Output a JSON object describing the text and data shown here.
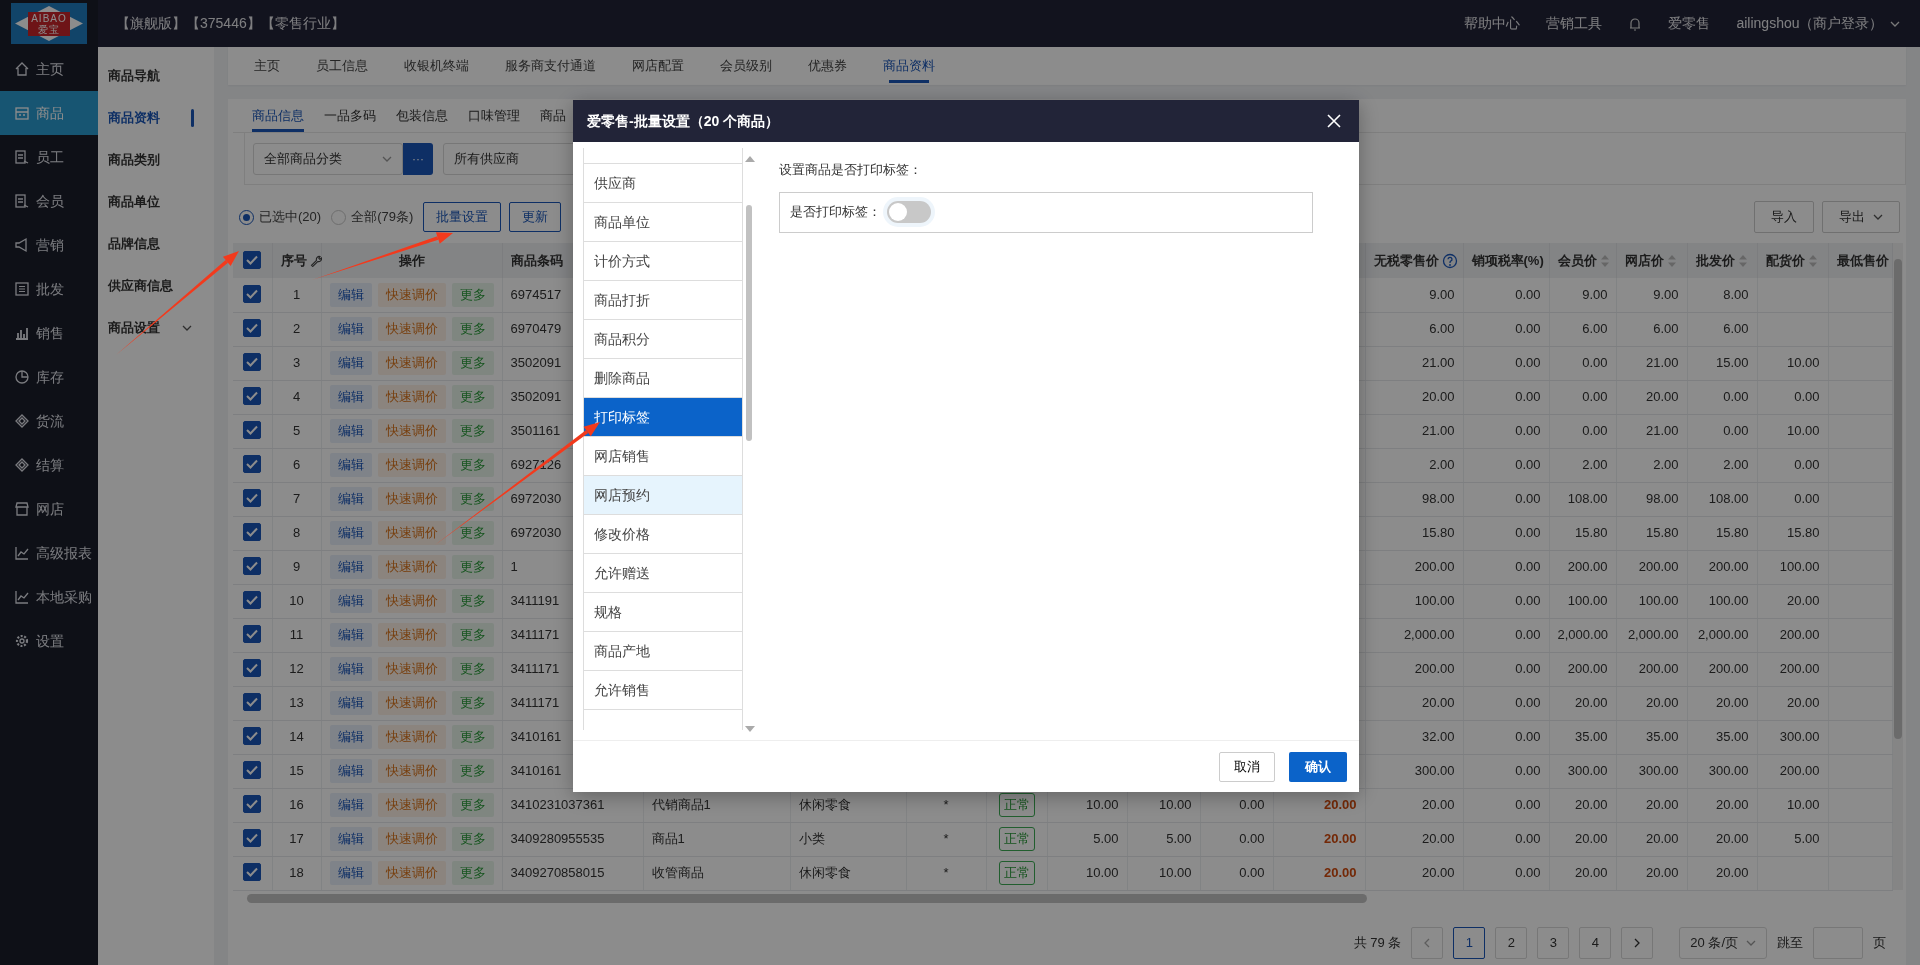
{
  "logo": {
    "text": "AIBAO",
    "subtext": "爱宝"
  },
  "header": {
    "title": "【旗舰版】【375446】【零售行业】",
    "links": [
      "帮助中心",
      "营销工具"
    ],
    "app": "爱零售",
    "user": "ailingshou（商户登录）"
  },
  "sidebar": {
    "items": [
      {
        "label": "主页",
        "selected": false
      },
      {
        "label": "商品",
        "selected": true
      },
      {
        "label": "员工",
        "selected": false
      },
      {
        "label": "会员",
        "selected": false
      },
      {
        "label": "营销",
        "selected": false
      },
      {
        "label": "批发",
        "selected": false
      },
      {
        "label": "销售",
        "selected": false
      },
      {
        "label": "库存",
        "selected": false
      },
      {
        "label": "货流",
        "selected": false
      },
      {
        "label": "结算",
        "selected": false
      },
      {
        "label": "网店",
        "selected": false
      },
      {
        "label": "高级报表",
        "selected": false
      },
      {
        "label": "本地采购",
        "selected": false
      },
      {
        "label": "设置",
        "selected": false
      }
    ]
  },
  "subnav": {
    "items": [
      {
        "label": "商品导航",
        "selected": false,
        "kind": "link"
      },
      {
        "label": "商品资料",
        "selected": true,
        "kind": "link"
      },
      {
        "label": "商品类别",
        "selected": false,
        "kind": "link"
      },
      {
        "label": "商品单位",
        "selected": false,
        "kind": "link"
      },
      {
        "label": "品牌信息",
        "selected": false,
        "kind": "link"
      },
      {
        "label": "供应商信息",
        "selected": false,
        "kind": "link"
      },
      {
        "label": "商品设置",
        "selected": false,
        "kind": "group",
        "expanded": false
      }
    ]
  },
  "tabs": [
    {
      "label": "主页",
      "selected": false
    },
    {
      "label": "员工信息",
      "selected": false
    },
    {
      "label": "收银机终端",
      "selected": false
    },
    {
      "label": "服务商支付通道",
      "selected": false
    },
    {
      "label": "网店配置",
      "selected": false
    },
    {
      "label": "会员级别",
      "selected": false
    },
    {
      "label": "优惠券",
      "selected": false
    },
    {
      "label": "商品资料",
      "selected": true
    }
  ],
  "subtabs": [
    {
      "label": "商品信息",
      "selected": true
    },
    {
      "label": "一品多码",
      "selected": false
    },
    {
      "label": "包装信息",
      "selected": false
    },
    {
      "label": "口味管理",
      "selected": false
    },
    {
      "label": "商品",
      "selected": false
    }
  ],
  "filters": {
    "category": "全部商品分类",
    "more": "···",
    "supplier": "所有供应商"
  },
  "scope": [
    {
      "label": "已选中(20)",
      "selected": true
    },
    {
      "label": "全部(79条)",
      "selected": false
    }
  ],
  "toolbar": {
    "buttons": [
      "批量设置",
      "更新"
    ],
    "right_buttons": [
      {
        "label": "导入",
        "dropdown": false
      },
      {
        "label": "导出",
        "dropdown": true
      }
    ]
  },
  "table": {
    "header_checked": true,
    "columns": [
      {
        "label": "序号",
        "kind": "index"
      },
      {
        "label": "操作",
        "kind": "actions"
      },
      {
        "label": "商品条码",
        "kind": "text"
      },
      {
        "kind": "text"
      },
      {
        "kind": "text"
      },
      {
        "kind": "center"
      },
      {
        "kind": "status"
      },
      {
        "kind": "num"
      },
      {
        "kind": "num"
      },
      {
        "kind": "num"
      },
      {
        "kind": "price"
      },
      {
        "label": "无税零售价",
        "kind": "num",
        "help": true
      },
      {
        "label": "销项税率(%)",
        "kind": "num"
      },
      {
        "label": "会员价",
        "kind": "num",
        "sortable": true
      },
      {
        "label": "网店价",
        "kind": "num",
        "sortable": true
      },
      {
        "label": "批发价",
        "kind": "num",
        "sortable": true
      },
      {
        "label": "配货价",
        "kind": "num",
        "sortable": true
      },
      {
        "label": "最低售价",
        "kind": "num"
      }
    ],
    "rows": [
      {
        "checked": true,
        "actions": [
          "编辑",
          "快速调价",
          "更多"
        ],
        "cells": [
          "1",
          null,
          "6974517",
          null,
          null,
          null,
          null,
          null,
          null,
          null,
          null,
          "9.00",
          "0.00",
          "9.00",
          "9.00",
          "8.00",
          null,
          null
        ]
      },
      {
        "checked": true,
        "actions": [
          "编辑",
          "快速调价",
          "更多"
        ],
        "cells": [
          "2",
          null,
          "6970479",
          null,
          null,
          null,
          null,
          null,
          null,
          null,
          null,
          "6.00",
          "0.00",
          "6.00",
          "6.00",
          "6.00",
          null,
          null
        ]
      },
      {
        "checked": true,
        "actions": [
          "编辑",
          "快速调价",
          "更多"
        ],
        "cells": [
          "3",
          null,
          "3502091",
          null,
          null,
          null,
          null,
          null,
          null,
          null,
          null,
          "21.00",
          "0.00",
          "0.00",
          "21.00",
          "15.00",
          "10.00",
          null
        ]
      },
      {
        "checked": true,
        "actions": [
          "编辑",
          "快速调价",
          "更多"
        ],
        "cells": [
          "4",
          null,
          "3502091",
          null,
          null,
          null,
          null,
          null,
          null,
          null,
          null,
          "20.00",
          "0.00",
          "0.00",
          "20.00",
          "0.00",
          "0.00",
          null
        ]
      },
      {
        "checked": true,
        "actions": [
          "编辑",
          "快速调价",
          "更多"
        ],
        "cells": [
          "5",
          null,
          "3501161",
          null,
          null,
          null,
          null,
          null,
          null,
          null,
          null,
          "21.00",
          "0.00",
          "0.00",
          "21.00",
          "0.00",
          "10.00",
          null
        ]
      },
      {
        "checked": true,
        "actions": [
          "编辑",
          "快速调价",
          "更多"
        ],
        "cells": [
          "6",
          null,
          "6927126",
          null,
          null,
          null,
          null,
          null,
          null,
          null,
          null,
          "2.00",
          "0.00",
          "2.00",
          "2.00",
          "2.00",
          "0.00",
          null
        ]
      },
      {
        "checked": true,
        "actions": [
          "编辑",
          "快速调价",
          "更多"
        ],
        "cells": [
          "7",
          null,
          "6972030",
          null,
          null,
          null,
          null,
          null,
          null,
          null,
          null,
          "98.00",
          "0.00",
          "108.00",
          "98.00",
          "108.00",
          "0.00",
          null
        ]
      },
      {
        "checked": true,
        "actions": [
          "编辑",
          "快速调价",
          "更多"
        ],
        "cells": [
          "8",
          null,
          "6972030",
          null,
          null,
          null,
          null,
          null,
          null,
          null,
          null,
          "15.80",
          "0.00",
          "15.80",
          "15.80",
          "15.80",
          "15.80",
          null
        ]
      },
      {
        "checked": true,
        "actions": [
          "编辑",
          "快速调价",
          "更多"
        ],
        "cells": [
          "9",
          null,
          "1",
          null,
          null,
          null,
          null,
          null,
          null,
          null,
          null,
          "200.00",
          "0.00",
          "200.00",
          "200.00",
          "200.00",
          "100.00",
          null
        ]
      },
      {
        "checked": true,
        "actions": [
          "编辑",
          "快速调价",
          "更多"
        ],
        "cells": [
          "10",
          null,
          "3411191",
          null,
          null,
          null,
          null,
          null,
          null,
          null,
          null,
          "100.00",
          "0.00",
          "100.00",
          "100.00",
          "100.00",
          "20.00",
          null
        ]
      },
      {
        "checked": true,
        "actions": [
          "编辑",
          "快速调价",
          "更多"
        ],
        "cells": [
          "11",
          null,
          "3411171",
          null,
          null,
          null,
          null,
          null,
          null,
          null,
          null,
          "2,000.00",
          "0.00",
          "2,000.00",
          "2,000.00",
          "2,000.00",
          "200.00",
          null
        ]
      },
      {
        "checked": true,
        "actions": [
          "编辑",
          "快速调价",
          "更多"
        ],
        "cells": [
          "12",
          null,
          "3411171",
          null,
          null,
          null,
          null,
          null,
          null,
          null,
          null,
          "200.00",
          "0.00",
          "200.00",
          "200.00",
          "200.00",
          "200.00",
          null
        ]
      },
      {
        "checked": true,
        "actions": [
          "编辑",
          "快速调价",
          "更多"
        ],
        "cells": [
          "13",
          null,
          "3411171",
          null,
          null,
          null,
          null,
          null,
          null,
          null,
          null,
          "20.00",
          "0.00",
          "20.00",
          "20.00",
          "20.00",
          "20.00",
          null
        ]
      },
      {
        "checked": true,
        "actions": [
          "编辑",
          "快速调价",
          "更多"
        ],
        "cells": [
          "14",
          null,
          "3410161",
          null,
          null,
          null,
          null,
          null,
          null,
          null,
          null,
          "32.00",
          "0.00",
          "35.00",
          "35.00",
          "35.00",
          "300.00",
          null
        ]
      },
      {
        "checked": true,
        "actions": [
          "编辑",
          "快速调价",
          "更多"
        ],
        "cells": [
          "15",
          null,
          "3410161",
          null,
          null,
          null,
          null,
          null,
          null,
          null,
          null,
          "300.00",
          "0.00",
          "300.00",
          "300.00",
          "300.00",
          "200.00",
          null
        ]
      },
      {
        "checked": true,
        "actions": [
          "编辑",
          "快速调价",
          "更多"
        ],
        "cells": [
          "16",
          null,
          "3410231037361",
          "代销商品1",
          "休闲零食",
          "*",
          "正常",
          "10.00",
          "10.00",
          "0.00",
          "20.00",
          "20.00",
          "0.00",
          "20.00",
          "20.00",
          "20.00",
          "10.00",
          null
        ]
      },
      {
        "checked": true,
        "actions": [
          "编辑",
          "快速调价",
          "更多"
        ],
        "cells": [
          "17",
          null,
          "3409280955535",
          "商品1",
          "小类",
          "*",
          "正常",
          "5.00",
          "5.00",
          "0.00",
          "20.00",
          "20.00",
          "0.00",
          "20.00",
          "20.00",
          "20.00",
          "5.00",
          null
        ]
      },
      {
        "checked": true,
        "actions": [
          "编辑",
          "快速调价",
          "更多"
        ],
        "cells": [
          "18",
          null,
          "3409270858015",
          "收管商品",
          "休闲零食",
          "*",
          "正常",
          "10.00",
          "10.00",
          "0.00",
          "20.00",
          "20.00",
          "0.00",
          "20.00",
          "20.00",
          "20.00",
          null,
          null
        ]
      }
    ]
  },
  "pagination": {
    "total": "共 79 条",
    "pages": [
      {
        "label": "1",
        "selected": true
      },
      {
        "label": "2",
        "selected": false
      },
      {
        "label": "3",
        "selected": false
      },
      {
        "label": "4",
        "selected": false
      }
    ],
    "page_size": "20 条/页",
    "jump_label": "跳至",
    "page_unit": "页"
  },
  "dialog": {
    "title": "爱零售-批量设置（20 个商品）",
    "menu": [
      {
        "label": "供应商",
        "selected": false,
        "hovered": false
      },
      {
        "label": "商品单位",
        "selected": false,
        "hovered": false
      },
      {
        "label": "计价方式",
        "selected": false,
        "hovered": false
      },
      {
        "label": "商品打折",
        "selected": false,
        "hovered": false
      },
      {
        "label": "商品积分",
        "selected": false,
        "hovered": false
      },
      {
        "label": "删除商品",
        "selected": false,
        "hovered": false
      },
      {
        "label": "打印标签",
        "selected": true,
        "hovered": false
      },
      {
        "label": "网店销售",
        "selected": false,
        "hovered": false
      },
      {
        "label": "网店预约",
        "selected": false,
        "hovered": true
      },
      {
        "label": "修改价格",
        "selected": false,
        "hovered": false
      },
      {
        "label": "允许赠送",
        "selected": false,
        "hovered": false
      },
      {
        "label": "规格",
        "selected": false,
        "hovered": false
      },
      {
        "label": "商品产地",
        "selected": false,
        "hovered": false
      },
      {
        "label": "允许销售",
        "selected": false,
        "hovered": false
      }
    ],
    "heading": "设置商品是否打印标签：",
    "field_label": "是否打印标签：",
    "toggle_on": false,
    "buttons": [
      "取消",
      "确认"
    ]
  }
}
